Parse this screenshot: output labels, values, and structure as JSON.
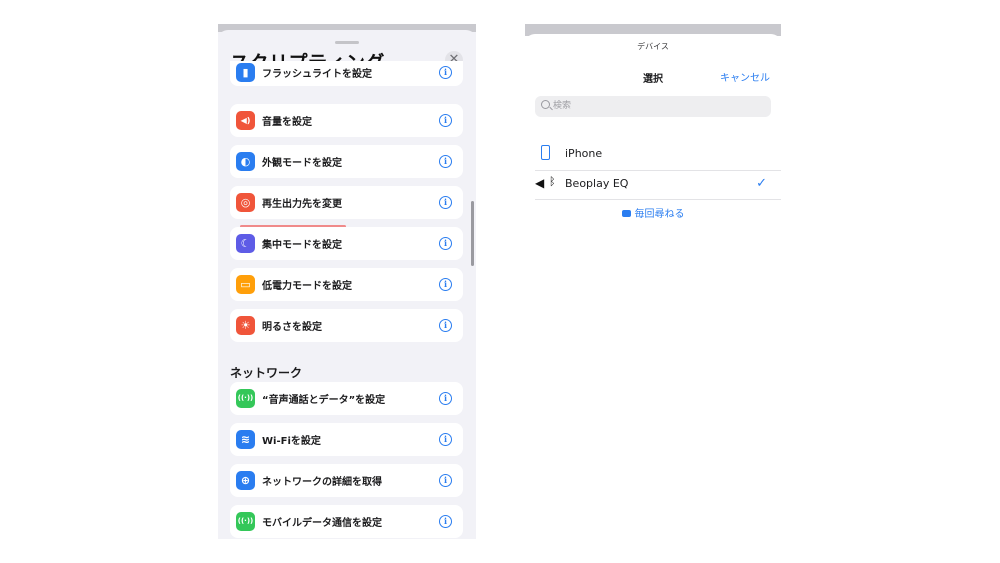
{
  "left_panel": {
    "title": "スクリプティング",
    "close_glyph": "✕",
    "rows": [
      {
        "label": "フラッシュライトを設定",
        "icon": "flashlight-icon",
        "glyph": "▮",
        "color": "#2a7df0"
      },
      {
        "label": "音量を設定",
        "icon": "speaker-volume-icon",
        "glyph": "◀)",
        "color": "#f0553a"
      },
      {
        "label": "外観モードを設定",
        "icon": "appearance-icon",
        "glyph": "◐",
        "color": "#2a7df0"
      },
      {
        "label": "再生出力先を変更",
        "icon": "airplay-audio-icon",
        "glyph": "◎",
        "color": "#f0553a"
      },
      {
        "label": "集中モードを設定",
        "icon": "moon-icon",
        "glyph": "☾",
        "color": "#5e5ce6"
      },
      {
        "label": "低電力モードを設定",
        "icon": "battery-icon",
        "glyph": "▭",
        "color": "#ff9f0a"
      },
      {
        "label": "明るさを設定",
        "icon": "sun-icon",
        "glyph": "☀",
        "color": "#f0553a"
      }
    ],
    "section_header": "ネットワーク",
    "network_rows": [
      {
        "label": "“音声通話とデータ”を設定",
        "icon": "cellular-antenna-icon",
        "glyph": "((·))",
        "color": "#34c759"
      },
      {
        "label": "Wi-Fiを設定",
        "icon": "wifi-icon",
        "glyph": "≋",
        "color": "#2a7df0"
      },
      {
        "label": "ネットワークの詳細を取得",
        "icon": "globe-icon",
        "glyph": "⊕",
        "color": "#2a7df0"
      },
      {
        "label": "モバイルデータ通信を設定",
        "icon": "cellular-antenna-icon",
        "glyph": "((·))",
        "color": "#34c759"
      }
    ],
    "info_glyph": "i"
  },
  "right_panel": {
    "caption": "デバイス",
    "nav_title": "選択",
    "cancel_label": "キャンセル",
    "search_placeholder": "検索",
    "devices": [
      {
        "label": "iPhone",
        "icon": "iphone-icon",
        "selected": false
      },
      {
        "label": "Beoplay EQ",
        "icon": "bluetooth-speaker-icon",
        "selected": true
      }
    ],
    "speaker_glyph": "◀",
    "bluetooth_glyph": "ᛒ",
    "check_glyph": "✓",
    "ask_every_time": "毎回尋ねる"
  },
  "colors": {
    "accent": "#2a7df0",
    "highlight_underline": "#f08a8a"
  }
}
